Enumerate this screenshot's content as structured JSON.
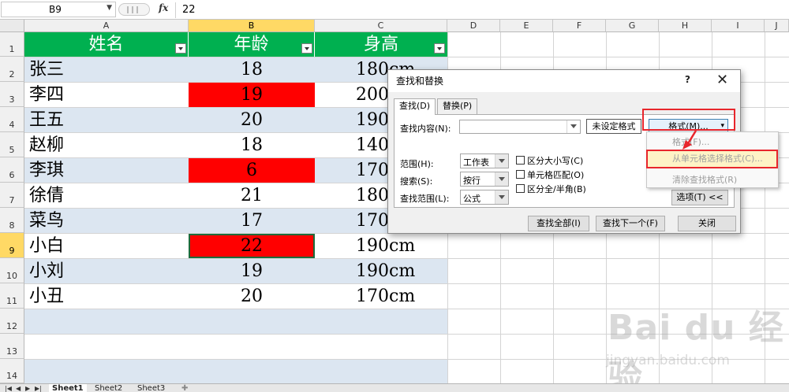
{
  "formula_bar": {
    "name_box": "B9",
    "fx": "fx",
    "value": "22"
  },
  "columns": [
    "A",
    "B",
    "C",
    "D",
    "E",
    "F",
    "G",
    "H",
    "I",
    "J"
  ],
  "rows": [
    "1",
    "2",
    "3",
    "4",
    "5",
    "6",
    "7",
    "8",
    "9",
    "10",
    "11",
    "12",
    "13",
    "14"
  ],
  "table": {
    "headers": [
      "姓名",
      "年龄",
      "身高"
    ],
    "rows": [
      {
        "name": "张三",
        "age": "18",
        "height": "180cm"
      },
      {
        "name": "李四",
        "age": "19",
        "height": "200cm"
      },
      {
        "name": "王五",
        "age": "20",
        "height": "190cm"
      },
      {
        "name": "赵柳",
        "age": "18",
        "height": "140cm"
      },
      {
        "name": "李琪",
        "age": "6",
        "height": "170cm"
      },
      {
        "name": "徐倩",
        "age": "21",
        "height": "180cm"
      },
      {
        "name": "菜鸟",
        "age": "17",
        "height": "170cm"
      },
      {
        "name": "小白",
        "age": "22",
        "height": "190cm"
      },
      {
        "name": "小刘",
        "age": "19",
        "height": "190cm"
      },
      {
        "name": "小丑",
        "age": "20",
        "height": "170cm"
      }
    ]
  },
  "sheets": [
    "Sheet1",
    "Sheet2",
    "Sheet3"
  ],
  "dialog": {
    "title": "查找和替换",
    "help": "?",
    "close": "✕",
    "tabs": [
      "查找(D)",
      "替换(P)"
    ],
    "find_label": "查找内容(N):",
    "find_value": "",
    "format_preview": "未设定格式",
    "format_button": "格式(M)...",
    "scope_label": "范围(H):",
    "scope_value": "工作表",
    "search_label": "搜索(S):",
    "search_value": "按行",
    "lookin_label": "查找范围(L):",
    "lookin_value": "公式",
    "opt_case": "区分大小写(C)",
    "opt_cell": "单元格匹配(O)",
    "opt_width": "区分全/半角(B)",
    "options_button": "选项(T) <<",
    "find_all": "查找全部(I)",
    "find_next": "查找下一个(F)",
    "close_button": "关闭"
  },
  "format_menu": [
    "格式(F)...",
    "从单元格选择格式(C)...",
    "清除查找格式(R)"
  ],
  "watermark": {
    "logo": "Bai du 经验",
    "url": "jingyan.baidu.com"
  },
  "colors": {
    "header_green": "#00b050",
    "band_blue": "#dce6f1",
    "highlight_red": "#ff0000",
    "annotation_red": "#e8262c"
  }
}
